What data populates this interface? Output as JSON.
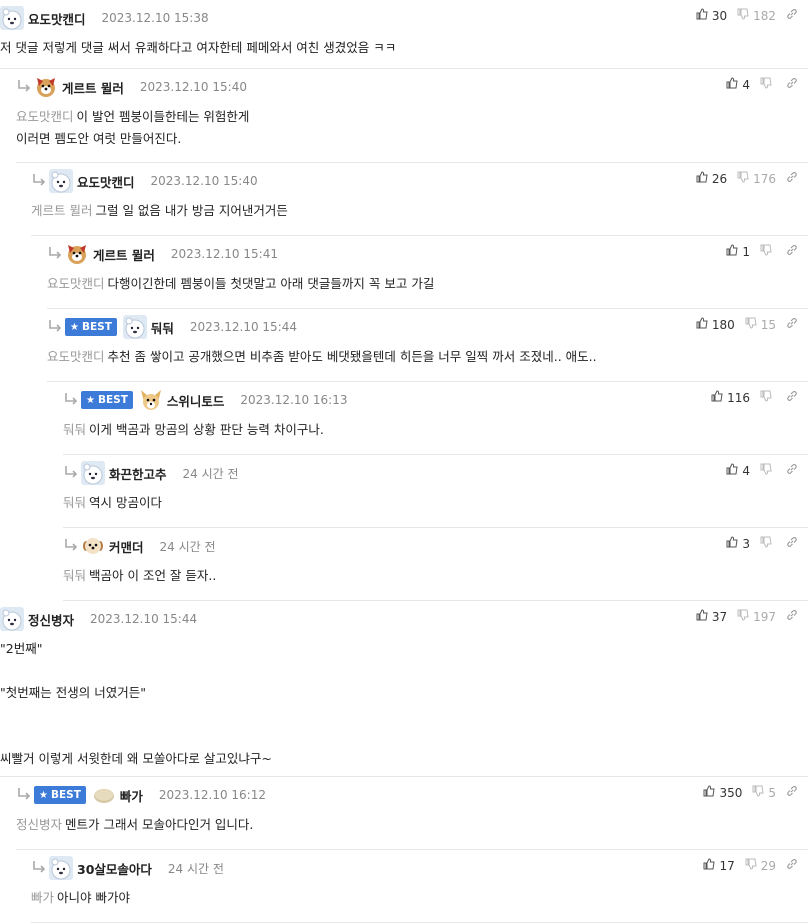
{
  "comments": [
    {
      "nick": "요도맛캔디",
      "date": "2023.12.10 15:38",
      "up": "30",
      "down": "182",
      "best": false,
      "mention": "",
      "text": "저 댓글 저렇게 댓글 써서 유쾌하다고 여자한테 페메와서 여친 생겼었음 ㅋㅋ"
    },
    {
      "nick": "게르트 뮐러",
      "date": "2023.12.10 15:40",
      "up": "4",
      "down": "",
      "best": false,
      "mention": "요도맛캔디",
      "text": "이 발언 펨붕이들한테는 위험한게\n이러면 펨도안 여럿 만들어진다."
    },
    {
      "nick": "요도맛캔디",
      "date": "2023.12.10 15:40",
      "up": "26",
      "down": "176",
      "best": false,
      "mention": "게르트 뮐러",
      "text": "그럴 일 없음 내가 방금 지어낸거거든"
    },
    {
      "nick": "게르트 뮐러",
      "date": "2023.12.10 15:41",
      "up": "1",
      "down": "",
      "best": false,
      "mention": "요도맛캔디",
      "text": "다행이긴한데 펨붕이들 첫댓말고 아래 댓글들까지 꼭 보고 가길"
    },
    {
      "nick": "둬둬",
      "date": "2023.12.10 15:44",
      "up": "180",
      "down": "15",
      "best": true,
      "mention": "요도맛캔디",
      "text": "추천 좀 쌓이고 공개했으면 비추좀 받아도 베댓됐을텐데 히든을 너무 일찍 까서 조졌네.. 애도.."
    },
    {
      "nick": "스위니토드",
      "date": "2023.12.10 16:13",
      "up": "116",
      "down": "",
      "best": true,
      "mention": "둬둬",
      "text": "이게 백곰과 망곰의 상황 판단 능력 차이구나."
    },
    {
      "nick": "화끈한고추",
      "date": "24 시간 전",
      "up": "4",
      "down": "",
      "best": false,
      "mention": "둬둬",
      "text": "역시 망곰이다"
    },
    {
      "nick": "커맨더",
      "date": "24 시간 전",
      "up": "3",
      "down": "",
      "best": false,
      "mention": "둬둬",
      "text": "백곰아 이 조언 잘 듣자.."
    },
    {
      "nick": "정신병자",
      "date": "2023.12.10 15:44",
      "up": "37",
      "down": "197",
      "best": false,
      "mention": "",
      "text": "\"2번째\"\n\n\"첫번째는 전생의 너였거든\"\n\n\n씨빨거 이렇게 서윗한데 왜 모쏠아다로 살고있냐구~"
    },
    {
      "nick": "빠가",
      "date": "2023.12.10 16:12",
      "up": "350",
      "down": "5",
      "best": true,
      "mention": "정신병자",
      "text": "멘트가 그래서 모솔아다인거 입니다."
    },
    {
      "nick": "30살모솔아다",
      "date": "24 시간 전",
      "up": "17",
      "down": "29",
      "best": false,
      "mention": "빠가",
      "text": "아니야 빠가야"
    }
  ],
  "best_label": "BEST",
  "icons": {
    "reply": "reply-arrow-icon",
    "up": "thumbs-up-icon",
    "down": "thumbs-down-icon",
    "link": "link-icon"
  },
  "colors": {
    "best_badge": "#3d7bd9",
    "mention": "#999999"
  }
}
